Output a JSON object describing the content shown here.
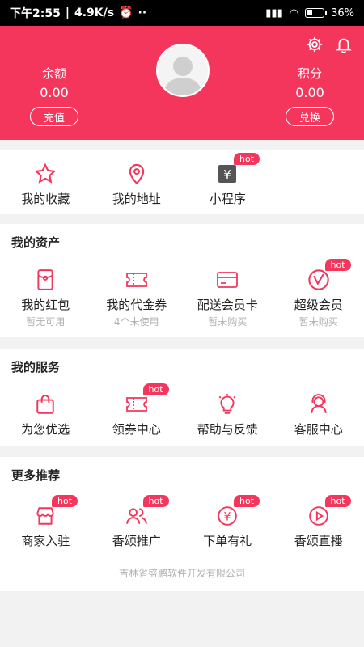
{
  "status": {
    "time": "下午2:55",
    "speed": "4.9K/s",
    "battery": "36%"
  },
  "header": {
    "balance_label": "余额",
    "balance_value": "0.00",
    "recharge_button": "充值",
    "points_label": "积分",
    "points_value": "0.00",
    "exchange_button": "兑换",
    "brand_color": "#f5365c"
  },
  "quick": [
    {
      "label": "我的收藏",
      "icon": "star-icon"
    },
    {
      "label": "我的地址",
      "icon": "location-icon"
    },
    {
      "label": "小程序",
      "icon": "mini-program-icon",
      "hot": "hot"
    }
  ],
  "assets": {
    "title": "我的资产",
    "items": [
      {
        "label": "我的红包",
        "sub": "暂无可用",
        "icon": "red-packet-icon"
      },
      {
        "label": "我的代金券",
        "sub": "4个未使用",
        "icon": "voucher-icon"
      },
      {
        "label": "配送会员卡",
        "sub": "暂未购买",
        "icon": "member-card-icon"
      },
      {
        "label": "超级会员",
        "sub": "暂未购买",
        "icon": "vip-icon",
        "hot": "hot"
      }
    ]
  },
  "services": {
    "title": "我的服务",
    "items": [
      {
        "label": "为您优选",
        "icon": "shopping-bag-icon"
      },
      {
        "label": "领券中心",
        "icon": "coupon-icon",
        "hot": "hot"
      },
      {
        "label": "帮助与反馈",
        "icon": "lightbulb-icon"
      },
      {
        "label": "客服中心",
        "icon": "headset-icon"
      }
    ]
  },
  "more": {
    "title": "更多推荐",
    "items": [
      {
        "label": "商家入驻",
        "icon": "merchant-icon",
        "hot": "hot"
      },
      {
        "label": "香颂推广",
        "icon": "users-icon",
        "hot": "hot"
      },
      {
        "label": "下单有礼",
        "icon": "gift-icon",
        "hot": "hot"
      },
      {
        "label": "香颂直播",
        "icon": "play-icon",
        "hot": "hot"
      }
    ]
  },
  "footer": {
    "text": "吉林省盛鹏软件开发有限公司"
  }
}
